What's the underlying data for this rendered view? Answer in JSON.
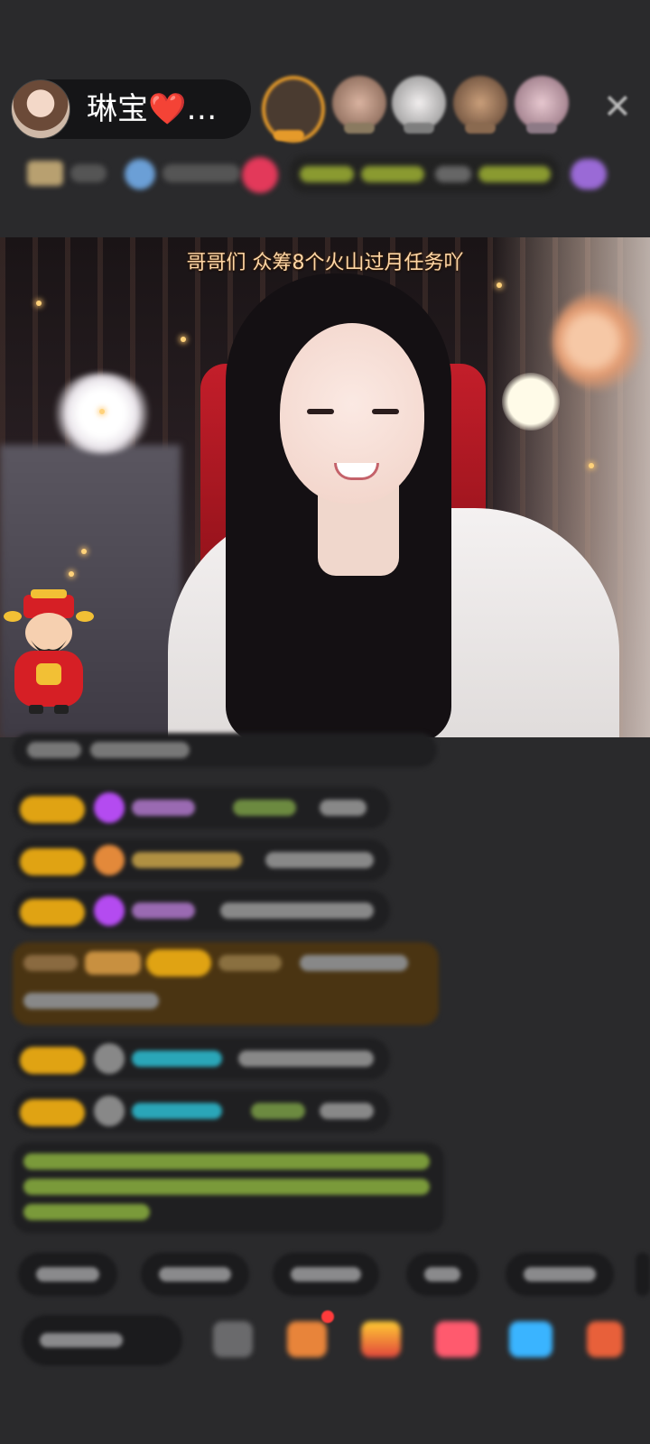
{
  "host": {
    "name": "琳宝❤️…"
  },
  "top_bar": {
    "close_icon": "close-icon",
    "viewer_avatars": [
      {
        "color": "#8b6a47"
      },
      {
        "color": "#c79a86"
      },
      {
        "color": "#d9d4d6"
      },
      {
        "color": "#a57a61"
      },
      {
        "color": "#b99aa6"
      }
    ]
  },
  "video": {
    "caption": "哥哥们 众筹8个火山过月任务吖",
    "sticker_icon": "god-of-wealth-icon"
  },
  "chat": {
    "icons": [
      "level-badge-icon",
      "diamond-icon",
      "avatar-icon"
    ]
  },
  "bottom_bar": {
    "icons": [
      "gift-icon",
      "box-icon",
      "present-icon",
      "pink-gift-icon",
      "blue-gift-icon",
      "more-icon"
    ],
    "colors": {
      "gold": "#e0a313",
      "purple": "#b44bf0",
      "teal": "#2aa6b8",
      "green": "#9bbf3a"
    }
  }
}
